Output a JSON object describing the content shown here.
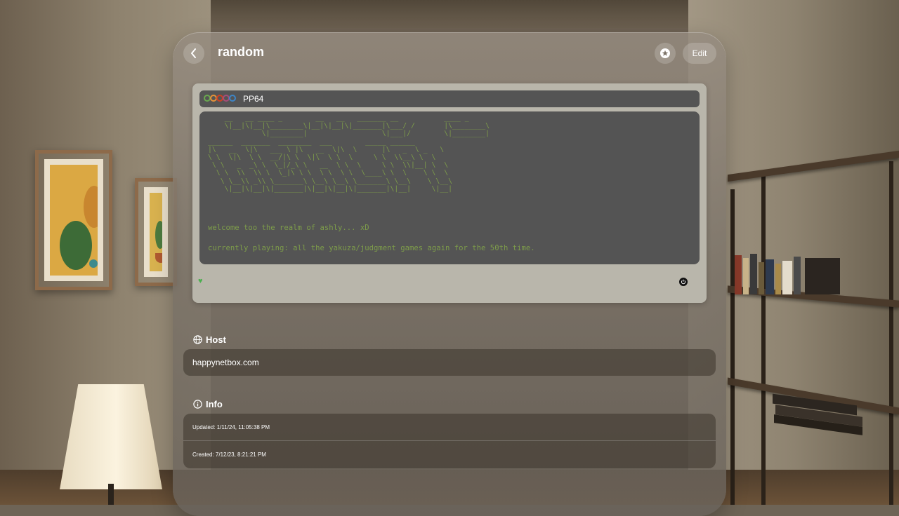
{
  "window": {
    "title": "random",
    "edit_label": "Edit"
  },
  "preview": {
    "topbar_label": "PP64",
    "ascii_art": "    __   __ ____ _        __   __   _______ __           ____ _\n    \\|__|\\|__|\\________\\|__|\\|__|\\|_______|\\___/ /       |\\________\\\n             \\|________|                  \\|___|/        \\|________|\n______  _______  ________  ___        _____ ______\n|\\   __  \\|\\   ___ \\ |\\   __  \\|\\  \\      |\\   _  \\ _   \\\n\\ \\  \\|\\  \\ \\  __/|\\ \\  \\|\\  \\ \\  \\     \\ \\  \\\\__\\ \\  \\\n \\ \\   _  _\\ \\  \\_|/_\\ \\   __  \\ \\  \\     \\ \\  \\\\|__| \\  \\\n  \\ \\  \\\\  \\\\ \\  \\_|\\ \\ \\  \\ \\  \\ \\  \\____\\ \\  \\    \\ \\  \\\n   \\ \\__\\\\ _\\\\ \\_______\\ \\__\\ \\__\\ \\_______\\ \\__\\    \\ \\__\\\n    \\|__|\\|__|\\|_______|\\|__|\\|__|\\|_______|\\|__|     \\|__|",
    "welcome_line": "welcome too the realm of ashly... xD",
    "playing_line": "currently playing: all the yakuza/judgment games again for the 50th time."
  },
  "host": {
    "heading": "Host",
    "value": "happynetbox.com"
  },
  "info": {
    "heading": "Info",
    "updated": "Updated: 1/11/24, 11:05:38 PM",
    "created": "Created: 7/12/23, 8:21:21 PM"
  },
  "colors": {
    "terminal_bg": "#545454",
    "terminal_text": "#7d9c4a",
    "heart": "#4caf50",
    "ring_colors": [
      "#6aa84f",
      "#e69138",
      "#cc4125",
      "#a64d79",
      "#3d85c6"
    ]
  },
  "icons": {
    "back": "chevron-left-icon",
    "favorite": "star-badge-icon",
    "host": "globe-icon",
    "info": "info-circle-icon",
    "heart": "heart-icon",
    "power": "power-icon"
  }
}
